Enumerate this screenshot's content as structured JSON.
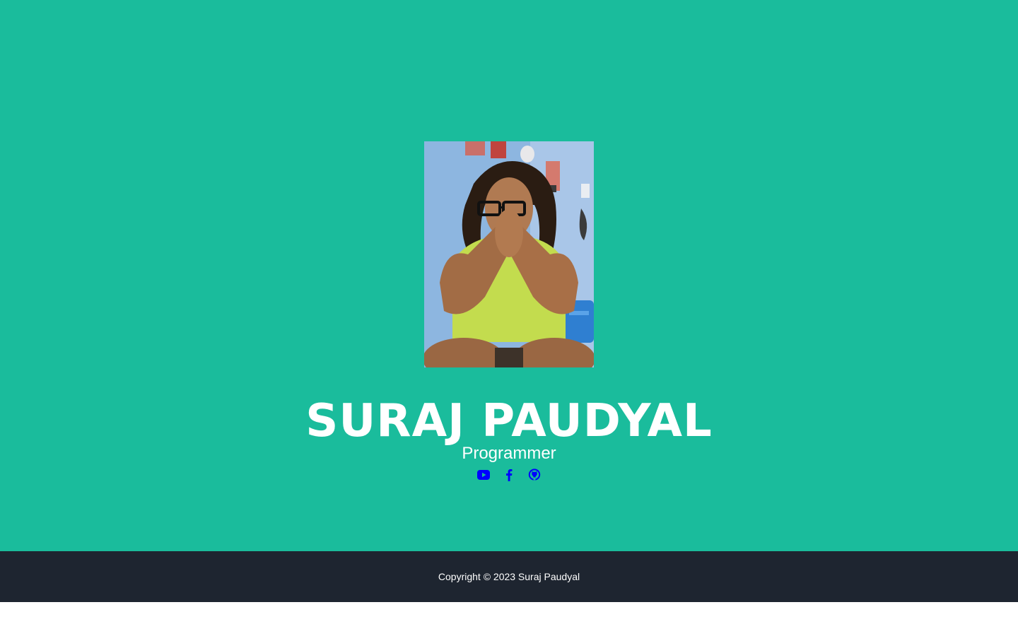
{
  "profile": {
    "name": "SURAJ PAUDYAL",
    "role": "Programmer",
    "photo_alt": "profile-photo"
  },
  "socials": [
    {
      "icon": "youtube-icon"
    },
    {
      "icon": "facebook-icon"
    },
    {
      "icon": "github-icon"
    }
  ],
  "footer": {
    "copyright": "Copyright © 2023 Suraj Paudyal"
  },
  "colors": {
    "hero_bg": "#1abc9c",
    "footer_bg": "#1e2530",
    "icon": "#0000ff",
    "text": "#ffffff"
  }
}
